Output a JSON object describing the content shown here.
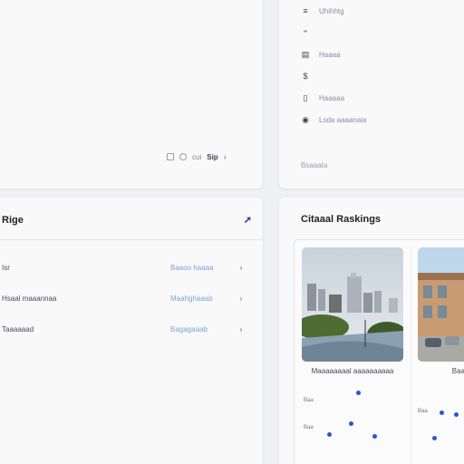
{
  "top_left": {
    "action_text": "cui",
    "action_text_2": "Sip",
    "chevron": "›"
  },
  "top_right": {
    "menu": [
      {
        "icon": "≡",
        "label": "Uhihhtg"
      },
      {
        "icon": "⁼",
        "label": ""
      },
      {
        "icon": "▤",
        "label": "Haaaa"
      },
      {
        "icon": "$",
        "label": ""
      },
      {
        "icon": "▯",
        "label": "Haaaaa"
      },
      {
        "icon": "◉",
        "label": "Lsda aaaanaia"
      }
    ],
    "footer": "Bsaaata"
  },
  "bottom_left": {
    "title": "Rige",
    "rows": [
      {
        "label": "Isr",
        "value": "Baaoo haaaa",
        "chevron": "›"
      },
      {
        "label": "Hsaal maaannaa",
        "value": "Maahghaaab",
        "chevron": "›"
      },
      {
        "label": "Taaaaaad",
        "value": "Bagagaaab",
        "chevron": "›"
      }
    ]
  },
  "bottom_right": {
    "title": "Citaaal Raskings",
    "tiles": [
      {
        "caption": "Maaaaaaaal aaaaaaaaaa"
      },
      {
        "caption": "Baaaaaaa"
      }
    ],
    "chart_labels": [
      "Baa",
      "Baa"
    ],
    "chart_labels_2": [
      "Baa"
    ]
  }
}
